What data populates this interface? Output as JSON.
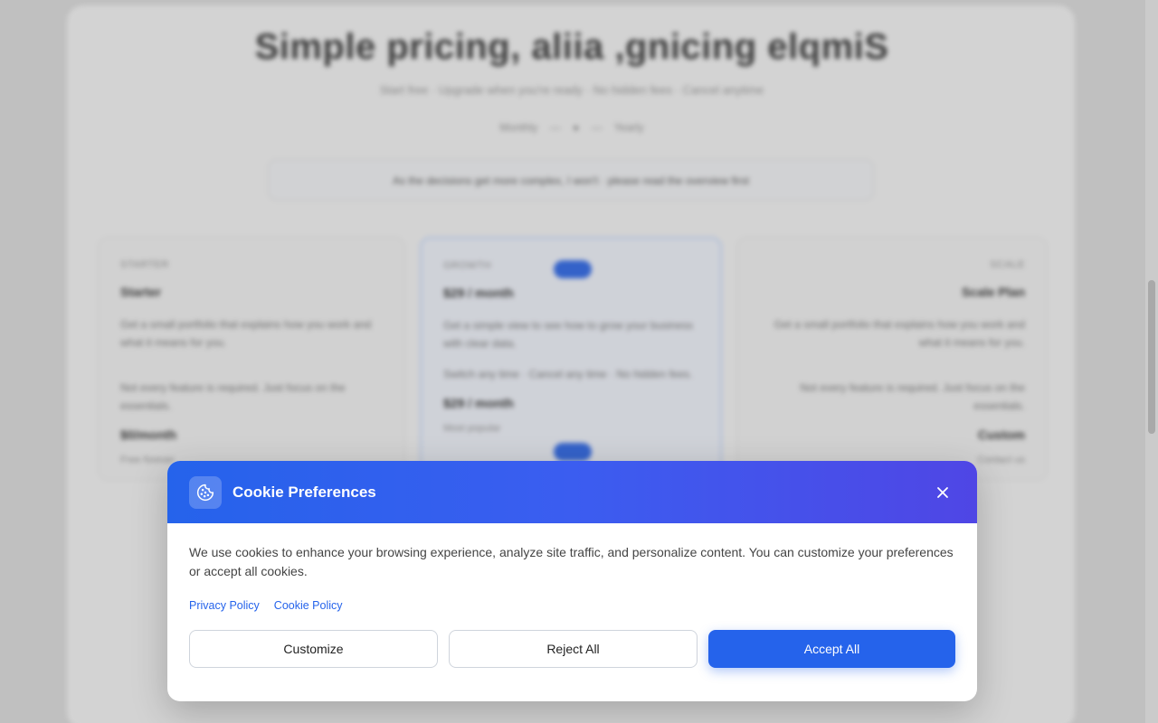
{
  "background": {
    "title": "Simple pricing, aliia ,gnicing elqmiS",
    "subtitle": "Start free · Upgrade when you're ready · No hidden fees · Cancel anytime",
    "toggle": {
      "monthly": "Monthly",
      "yearly": "Yearly"
    },
    "banner": "As the decisions get more complex, I won't · please read the overview first",
    "plans": [
      {
        "cap": "STARTER",
        "name": "Starter",
        "text": "Get a small portfolio that explains how you work and what it means for you.",
        "text2": "Not every feature is required. Just focus on the essentials.",
        "price": "$0/month",
        "foot": "Free forever"
      },
      {
        "cap": "GROWTH",
        "name": "$29 / month",
        "text": "Get a simple view to see how to grow your business with clear data.",
        "text2": "Switch any time · Cancel any time · No hidden fees.",
        "price": "$29 / month",
        "foot": "Most popular"
      },
      {
        "cap": "SCALE",
        "name": "Scale Plan",
        "text": "Get a small portfolio that explains how you work and what it means for you.",
        "text2": "Not every feature is required. Just focus on the essentials.",
        "price": "Custom",
        "foot": "Contact us"
      }
    ]
  },
  "modal": {
    "title": "Cookie Preferences",
    "description": "We use cookies to enhance your browsing experience, analyze site traffic, and personalize content. You can customize your preferences or accept all cookies.",
    "links": {
      "privacy": "Privacy Policy",
      "cookie": "Cookie Policy"
    },
    "buttons": {
      "customize": "Customize",
      "reject": "Reject All",
      "accept": "Accept All"
    },
    "icons": {
      "header": "cookie-icon",
      "close": "close-icon"
    }
  },
  "colors": {
    "accent": "#2563eb",
    "header_gradient_end": "#4f46e5"
  }
}
